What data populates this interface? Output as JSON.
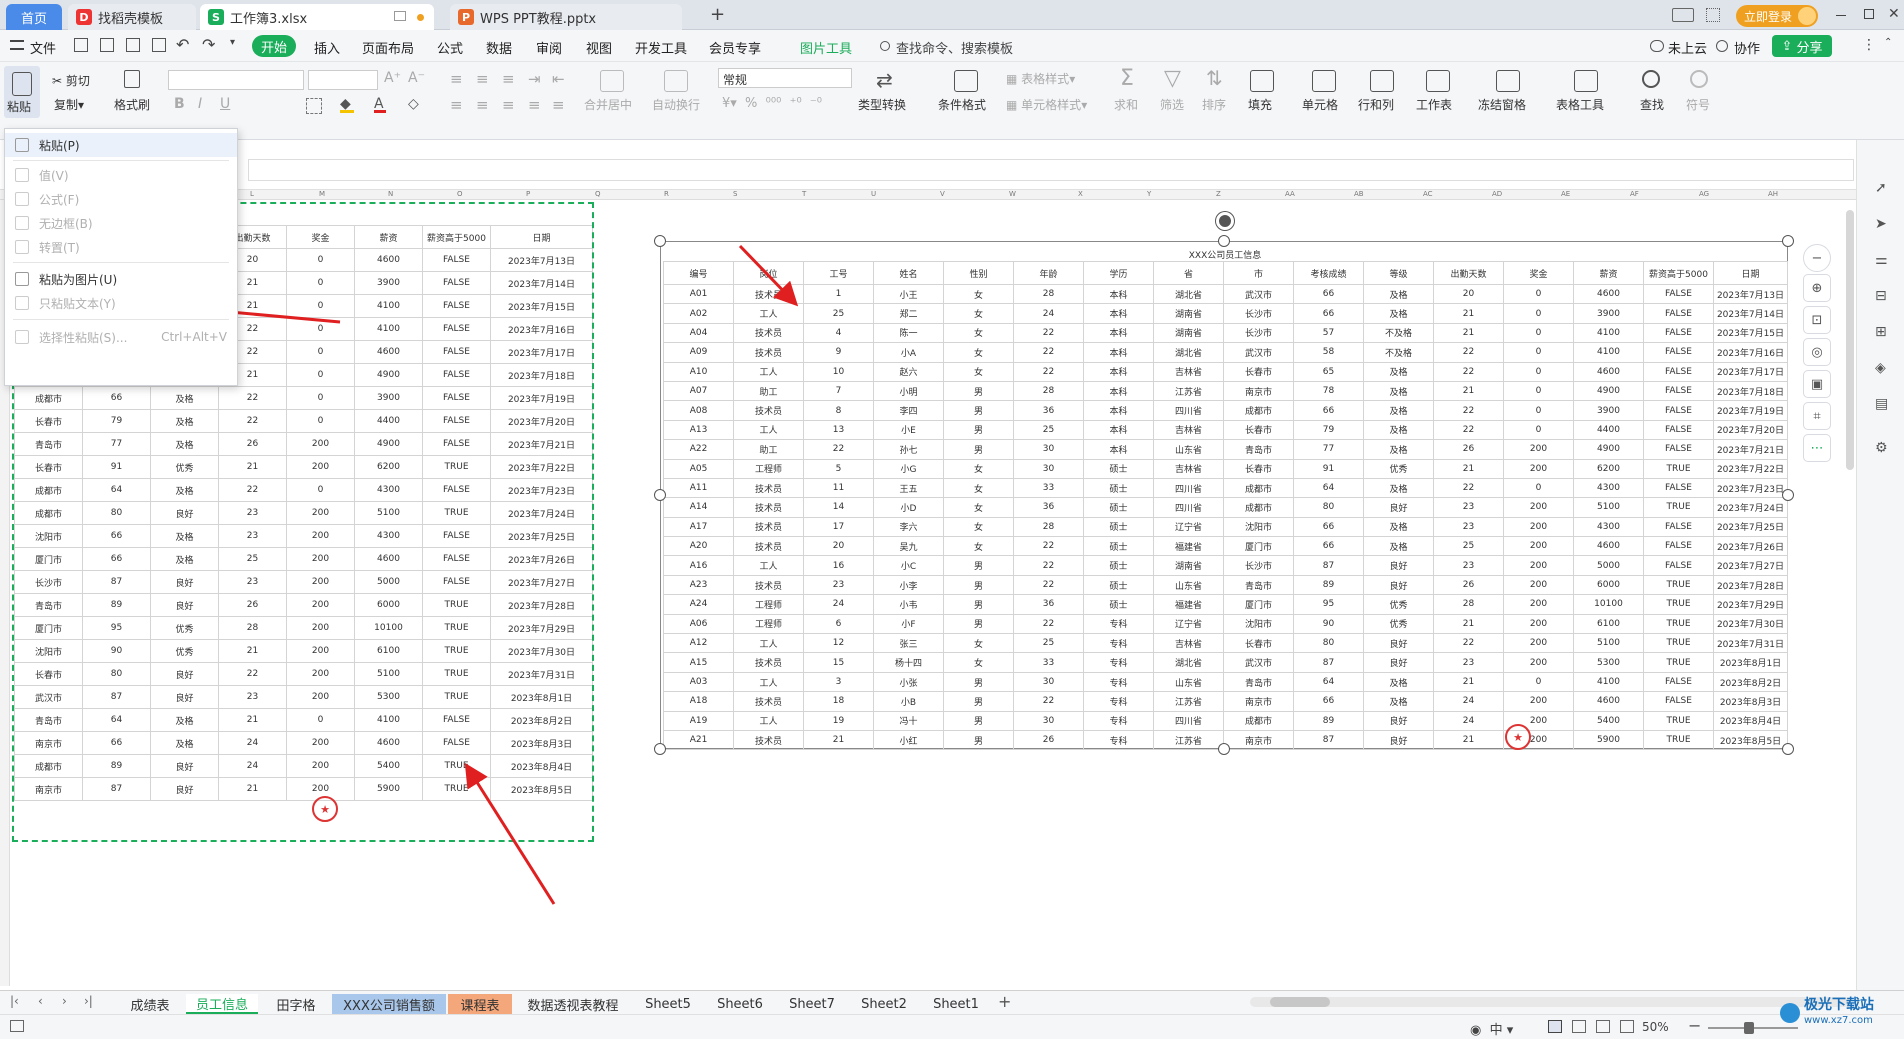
{
  "titlebar": {
    "tabs": [
      {
        "label": "首页",
        "icon": ""
      },
      {
        "label": "找稻壳模板",
        "icon": "D"
      },
      {
        "label": "工作簿3.xlsx",
        "icon": "S"
      },
      {
        "label": "WPS PPT教程.pptx",
        "icon": "P"
      }
    ],
    "add_tab": "+",
    "login_button": "立即登录"
  },
  "menubar": {
    "file": "文件",
    "items": [
      "开始",
      "插入",
      "页面布局",
      "公式",
      "数据",
      "审阅",
      "视图",
      "开发工具",
      "会员专享",
      "图片工具"
    ],
    "search": "查找命令、搜索模板",
    "cloud": "未上云",
    "collab": "协作",
    "share": "分享"
  },
  "ribbon": {
    "paste": "粘贴",
    "cut": "剪切",
    "copy": "复制",
    "format_painter": "格式刷",
    "bold": "B",
    "merge_center": "合并居中",
    "wrap": "自动换行",
    "number_format": "常规",
    "type_convert": "类型转换",
    "cond_format": "条件格式",
    "table_style": "表格样式",
    "cell_style": "单元格样式",
    "sum": "求和",
    "filter": "筛选",
    "sort": "排序",
    "fill": "填充",
    "cell": "单元格",
    "rowcol": "行和列",
    "worksheet": "工作表",
    "freeze": "冻结窗格",
    "table_tools": "表格工具",
    "find": "查找",
    "symbol": "符号"
  },
  "paste_menu": {
    "items": [
      {
        "label": "粘贴(P)",
        "enabled": true
      },
      {
        "label": "值(V)",
        "enabled": false
      },
      {
        "label": "公式(F)",
        "enabled": false
      },
      {
        "label": "无边框(B)",
        "enabled": false
      },
      {
        "label": "转置(T)",
        "enabled": false
      },
      {
        "label": "粘贴为图片(U)",
        "enabled": true
      },
      {
        "label": "只粘贴文本(Y)",
        "enabled": false
      },
      {
        "label": "选择性粘贴(S)...",
        "enabled": false,
        "shortcut": "Ctrl+Alt+V"
      }
    ]
  },
  "left_table": {
    "headers": [
      "出勤天数",
      "奖金",
      "薪资",
      "薪资高于5000",
      "日期"
    ],
    "rows": [
      [
        "",
        "",
        "",
        "20",
        "0",
        "4600",
        "FALSE",
        "2023年7月13日"
      ],
      [
        "",
        "",
        "",
        "21",
        "0",
        "3900",
        "FALSE",
        "2023年7月14日"
      ],
      [
        "",
        "",
        "",
        "21",
        "0",
        "4100",
        "FALSE",
        "2023年7月15日"
      ],
      [
        "",
        "",
        "",
        "22",
        "0",
        "4100",
        "FALSE",
        "2023年7月16日"
      ],
      [
        "",
        "",
        "",
        "22",
        "0",
        "4600",
        "FALSE",
        "2023年7月17日"
      ],
      [
        "",
        "",
        "",
        "21",
        "0",
        "4900",
        "FALSE",
        "2023年7月18日"
      ],
      [
        "成都市",
        "66",
        "及格",
        "22",
        "0",
        "3900",
        "FALSE",
        "2023年7月19日"
      ],
      [
        "长春市",
        "79",
        "及格",
        "22",
        "0",
        "4400",
        "FALSE",
        "2023年7月20日"
      ],
      [
        "青岛市",
        "77",
        "及格",
        "26",
        "200",
        "4900",
        "FALSE",
        "2023年7月21日"
      ],
      [
        "长春市",
        "91",
        "优秀",
        "21",
        "200",
        "6200",
        "TRUE",
        "2023年7月22日"
      ],
      [
        "成都市",
        "64",
        "及格",
        "22",
        "0",
        "4300",
        "FALSE",
        "2023年7月23日"
      ],
      [
        "成都市",
        "80",
        "良好",
        "23",
        "200",
        "5100",
        "TRUE",
        "2023年7月24日"
      ],
      [
        "沈阳市",
        "66",
        "及格",
        "23",
        "200",
        "4300",
        "FALSE",
        "2023年7月25日"
      ],
      [
        "厦门市",
        "66",
        "及格",
        "25",
        "200",
        "4600",
        "FALSE",
        "2023年7月26日"
      ],
      [
        "长沙市",
        "87",
        "良好",
        "23",
        "200",
        "5000",
        "FALSE",
        "2023年7月27日"
      ],
      [
        "青岛市",
        "89",
        "良好",
        "26",
        "200",
        "6000",
        "TRUE",
        "2023年7月28日"
      ],
      [
        "厦门市",
        "95",
        "优秀",
        "28",
        "200",
        "10100",
        "TRUE",
        "2023年7月29日"
      ],
      [
        "沈阳市",
        "90",
        "优秀",
        "21",
        "200",
        "6100",
        "TRUE",
        "2023年7月30日"
      ],
      [
        "长春市",
        "80",
        "良好",
        "22",
        "200",
        "5100",
        "TRUE",
        "2023年7月31日"
      ],
      [
        "武汉市",
        "87",
        "良好",
        "23",
        "200",
        "5300",
        "TRUE",
        "2023年8月1日"
      ],
      [
        "青岛市",
        "64",
        "及格",
        "21",
        "0",
        "4100",
        "FALSE",
        "2023年8月2日"
      ],
      [
        "南京市",
        "66",
        "及格",
        "24",
        "200",
        "4600",
        "FALSE",
        "2023年8月3日"
      ],
      [
        "成都市",
        "89",
        "良好",
        "24",
        "200",
        "5400",
        "TRUE",
        "2023年8月4日"
      ],
      [
        "南京市",
        "87",
        "良好",
        "21",
        "200",
        "5900",
        "TRUE",
        "2023年8月5日"
      ]
    ]
  },
  "right_table": {
    "title": "XXX公司员工信息",
    "headers": [
      "编号",
      "岗位",
      "工号",
      "姓名",
      "性别",
      "年龄",
      "学历",
      "省",
      "市",
      "考核成绩",
      "等级",
      "出勤天数",
      "奖金",
      "薪资",
      "薪资高于5000",
      "日期"
    ],
    "rows": [
      [
        "A01",
        "技术员",
        "1",
        "小王",
        "女",
        "28",
        "本科",
        "湖北省",
        "武汉市",
        "66",
        "及格",
        "20",
        "0",
        "4600",
        "FALSE",
        "2023年7月13日"
      ],
      [
        "A02",
        "工人",
        "25",
        "郑二",
        "女",
        "24",
        "本科",
        "湖南省",
        "长沙市",
        "66",
        "及格",
        "21",
        "0",
        "3900",
        "FALSE",
        "2023年7月14日"
      ],
      [
        "A04",
        "技术员",
        "4",
        "陈一",
        "女",
        "22",
        "本科",
        "湖南省",
        "长沙市",
        "57",
        "不及格",
        "21",
        "0",
        "4100",
        "FALSE",
        "2023年7月15日"
      ],
      [
        "A09",
        "技术员",
        "9",
        "小A",
        "女",
        "22",
        "本科",
        "湖北省",
        "武汉市",
        "58",
        "不及格",
        "22",
        "0",
        "4100",
        "FALSE",
        "2023年7月16日"
      ],
      [
        "A10",
        "工人",
        "10",
        "赵六",
        "女",
        "22",
        "本科",
        "吉林省",
        "长春市",
        "65",
        "及格",
        "22",
        "0",
        "4600",
        "FALSE",
        "2023年7月17日"
      ],
      [
        "A07",
        "助工",
        "7",
        "小明",
        "男",
        "28",
        "本科",
        "江苏省",
        "南京市",
        "78",
        "及格",
        "21",
        "0",
        "4900",
        "FALSE",
        "2023年7月18日"
      ],
      [
        "A08",
        "技术员",
        "8",
        "李四",
        "男",
        "36",
        "本科",
        "四川省",
        "成都市",
        "66",
        "及格",
        "22",
        "0",
        "3900",
        "FALSE",
        "2023年7月19日"
      ],
      [
        "A13",
        "工人",
        "13",
        "小E",
        "男",
        "25",
        "本科",
        "吉林省",
        "长春市",
        "79",
        "及格",
        "22",
        "0",
        "4400",
        "FALSE",
        "2023年7月20日"
      ],
      [
        "A22",
        "助工",
        "22",
        "孙七",
        "男",
        "30",
        "本科",
        "山东省",
        "青岛市",
        "77",
        "及格",
        "26",
        "200",
        "4900",
        "FALSE",
        "2023年7月21日"
      ],
      [
        "A05",
        "工程师",
        "5",
        "小G",
        "女",
        "30",
        "硕士",
        "吉林省",
        "长春市",
        "91",
        "优秀",
        "21",
        "200",
        "6200",
        "TRUE",
        "2023年7月22日"
      ],
      [
        "A11",
        "技术员",
        "11",
        "王五",
        "女",
        "33",
        "硕士",
        "四川省",
        "成都市",
        "64",
        "及格",
        "22",
        "0",
        "4300",
        "FALSE",
        "2023年7月23日"
      ],
      [
        "A14",
        "技术员",
        "14",
        "小D",
        "女",
        "36",
        "硕士",
        "四川省",
        "成都市",
        "80",
        "良好",
        "23",
        "200",
        "5100",
        "TRUE",
        "2023年7月24日"
      ],
      [
        "A17",
        "技术员",
        "17",
        "李六",
        "女",
        "28",
        "硕士",
        "辽宁省",
        "沈阳市",
        "66",
        "及格",
        "23",
        "200",
        "4300",
        "FALSE",
        "2023年7月25日"
      ],
      [
        "A20",
        "技术员",
        "20",
        "吴九",
        "女",
        "22",
        "硕士",
        "福建省",
        "厦门市",
        "66",
        "及格",
        "25",
        "200",
        "4600",
        "FALSE",
        "2023年7月26日"
      ],
      [
        "A16",
        "工人",
        "16",
        "小C",
        "男",
        "22",
        "硕士",
        "湖南省",
        "长沙市",
        "87",
        "良好",
        "23",
        "200",
        "5000",
        "FALSE",
        "2023年7月27日"
      ],
      [
        "A23",
        "技术员",
        "23",
        "小李",
        "男",
        "22",
        "硕士",
        "山东省",
        "青岛市",
        "89",
        "良好",
        "26",
        "200",
        "6000",
        "TRUE",
        "2023年7月28日"
      ],
      [
        "A24",
        "工程师",
        "24",
        "小韦",
        "男",
        "36",
        "硕士",
        "福建省",
        "厦门市",
        "95",
        "优秀",
        "28",
        "200",
        "10100",
        "TRUE",
        "2023年7月29日"
      ],
      [
        "A06",
        "工程师",
        "6",
        "小F",
        "男",
        "22",
        "专科",
        "辽宁省",
        "沈阳市",
        "90",
        "优秀",
        "21",
        "200",
        "6100",
        "TRUE",
        "2023年7月30日"
      ],
      [
        "A12",
        "工人",
        "12",
        "张三",
        "女",
        "25",
        "专科",
        "吉林省",
        "长春市",
        "80",
        "良好",
        "22",
        "200",
        "5100",
        "TRUE",
        "2023年7月31日"
      ],
      [
        "A15",
        "技术员",
        "15",
        "杨十四",
        "女",
        "33",
        "专科",
        "湖北省",
        "武汉市",
        "87",
        "良好",
        "23",
        "200",
        "5300",
        "TRUE",
        "2023年8月1日"
      ],
      [
        "A03",
        "工人",
        "3",
        "小张",
        "男",
        "30",
        "专科",
        "山东省",
        "青岛市",
        "64",
        "及格",
        "21",
        "0",
        "4100",
        "FALSE",
        "2023年8月2日"
      ],
      [
        "A18",
        "技术员",
        "18",
        "小B",
        "男",
        "22",
        "专科",
        "江苏省",
        "南京市",
        "66",
        "及格",
        "24",
        "200",
        "4600",
        "FALSE",
        "2023年8月3日"
      ],
      [
        "A19",
        "工人",
        "19",
        "冯十",
        "男",
        "30",
        "专科",
        "四川省",
        "成都市",
        "89",
        "良好",
        "24",
        "200",
        "5400",
        "TRUE",
        "2023年8月4日"
      ],
      [
        "A21",
        "技术员",
        "21",
        "小红",
        "男",
        "26",
        "专科",
        "江苏省",
        "南京市",
        "87",
        "良好",
        "21",
        "200",
        "5900",
        "TRUE",
        "2023年8月5日"
      ]
    ]
  },
  "col_letters": [
    "L",
    "M",
    "N",
    "O",
    "P",
    "Q",
    "R",
    "S",
    "T",
    "U",
    "V",
    "W",
    "X",
    "Y",
    "Z",
    "AA",
    "AB",
    "AC",
    "AD",
    "AE",
    "AF",
    "AG",
    "AH"
  ],
  "sheet_tabs": [
    "成绩表",
    "员工信息",
    "田字格",
    "XXX公司销售额",
    "课程表",
    "数据透视表教程",
    "Sheet5",
    "Sheet6",
    "Sheet7",
    "Sheet2",
    "Sheet1"
  ],
  "active_sheet": "员工信息",
  "status": {
    "zoom": "50%",
    "input": "中"
  },
  "watermark": "极光下载站",
  "watermark_url": "www.xz7.com",
  "colors": {
    "accent": "#1aad5a",
    "tab_orange": "#f3a77b",
    "tab_blue": "#a9c7ea",
    "arrow": "#e02020"
  }
}
